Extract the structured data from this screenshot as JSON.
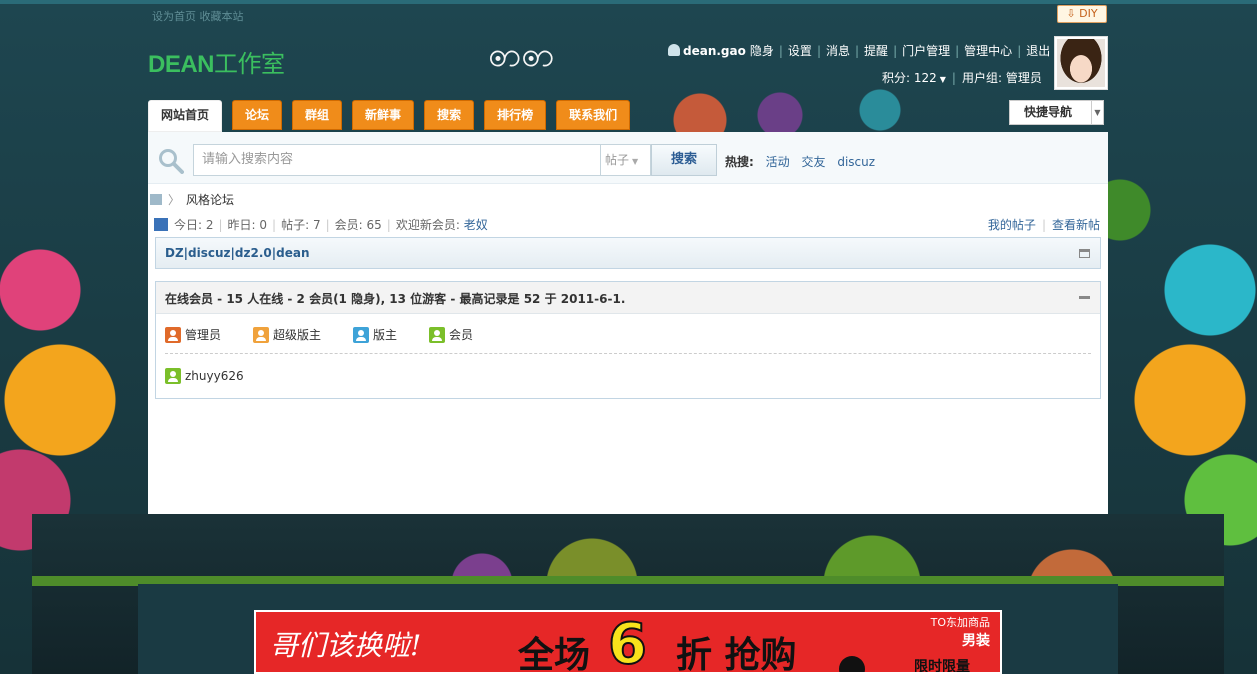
{
  "topbar": {
    "left_links": "设为首页  收藏本站",
    "diy_label": "⇩ DIY"
  },
  "logo": {
    "en": "DEAN",
    "cn": "工作室"
  },
  "user": {
    "name": "dean.gao",
    "invisible": "隐身",
    "links": [
      "设置",
      "消息",
      "提醒",
      "门户管理",
      "管理中心",
      "退出"
    ],
    "points_label": "积分: 122",
    "group_label": "用户组: 管理员"
  },
  "nav": {
    "tabs": [
      "网站首页",
      "论坛",
      "群组",
      "新鲜事",
      "搜索",
      "排行榜",
      "联系我们"
    ],
    "active_index": 0,
    "quick_nav": "快捷导航"
  },
  "search": {
    "placeholder": "请输入搜索内容",
    "type": "帖子",
    "button": "搜索",
    "hot_label": "热搜:",
    "hot_terms": [
      "活动",
      "交友",
      "discuz"
    ]
  },
  "breadcrumb": {
    "current": "风格论坛"
  },
  "stats": {
    "today": "今日: 2",
    "yesterday": "昨日: 0",
    "posts": "帖子: 7",
    "members": "会员: 65",
    "welcome": "欢迎新会员:",
    "newest_member": "老奴",
    "my_posts": "我的帖子",
    "new_posts": "查看新帖"
  },
  "forum_box": {
    "title": "DZ|discuz|dz2.0|dean"
  },
  "online": {
    "header": "在线会员 - 15 人在线 - 2 会员(1 隐身), 13 位游客 - 最高记录是 52 于 2011-6-1.",
    "legend": [
      "管理员",
      "超级版主",
      "版主",
      "会员"
    ],
    "users": [
      "zhuyy626"
    ]
  },
  "ad": {
    "slogan": "哥们该换啦!",
    "headline_pre": "全场",
    "headline_num": "6",
    "headline_post": "折 抢购",
    "brand_top": "TO东加商品",
    "brand": "男装",
    "limit": "限时限量"
  },
  "colors": {
    "accent_orange": "#f08c1a",
    "logo_green": "#3bbf5f",
    "link_blue": "#336699",
    "ad_red": "#e62727"
  }
}
